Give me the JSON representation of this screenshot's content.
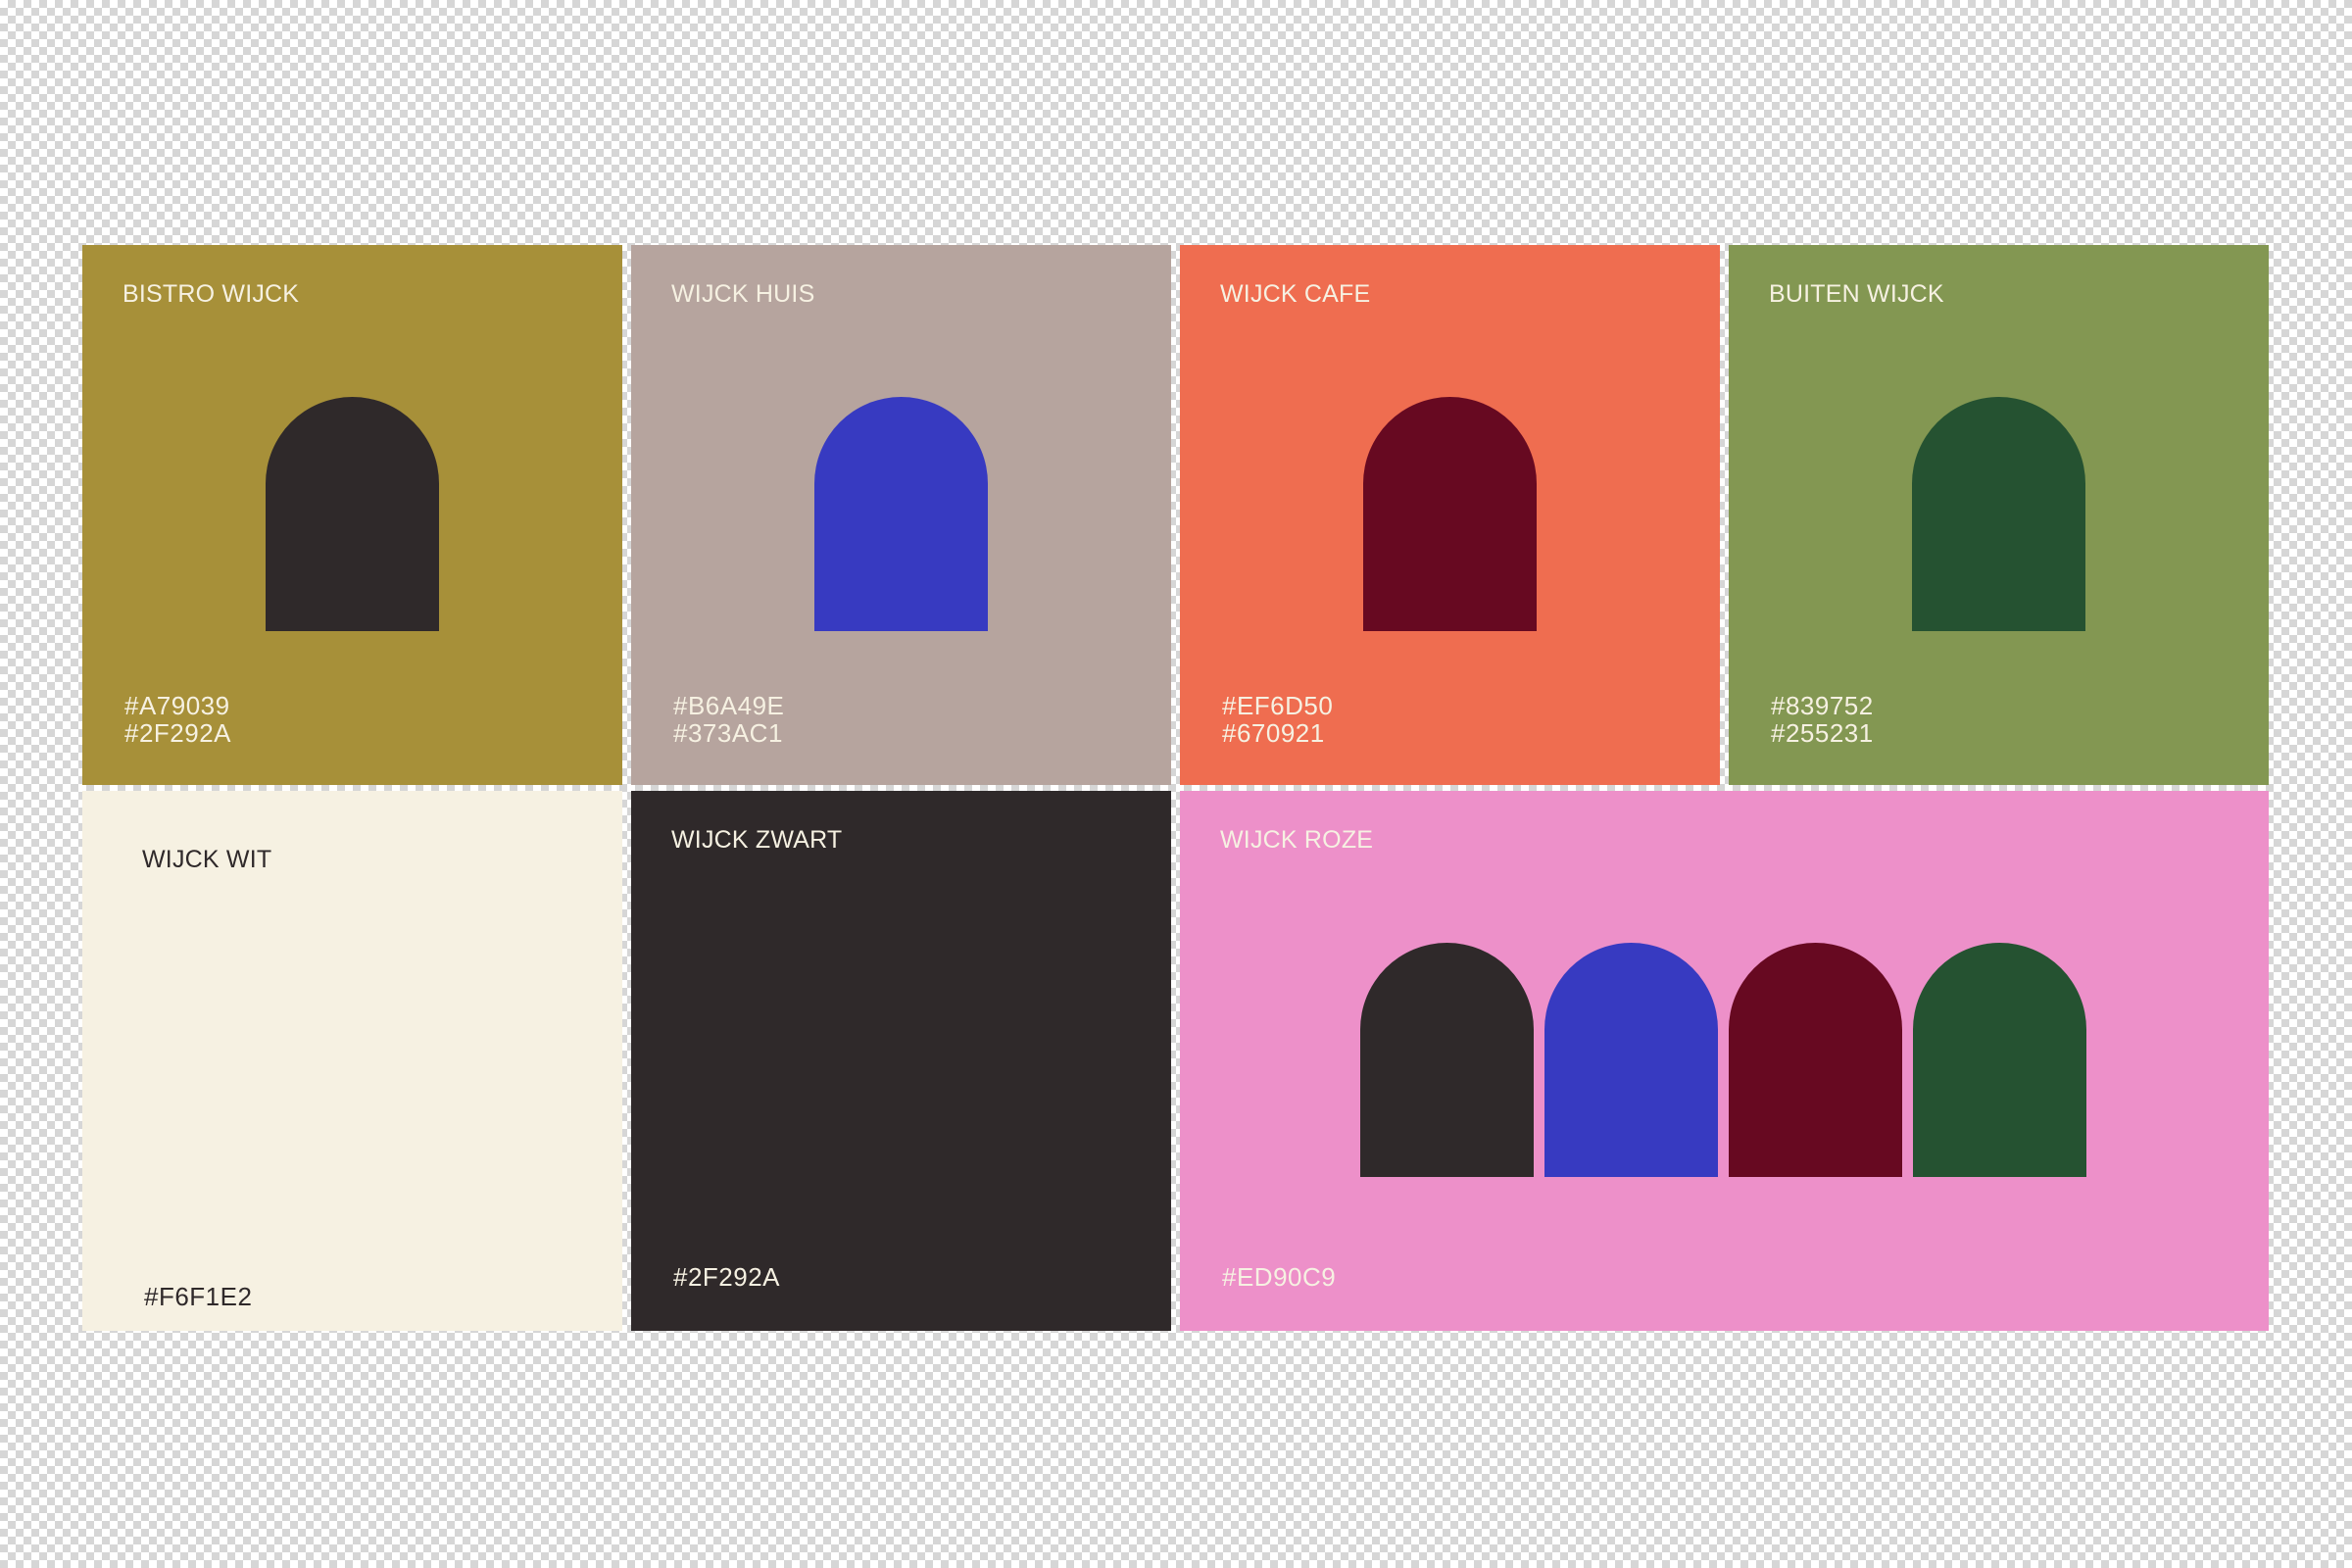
{
  "tiles": {
    "bistro": {
      "name": "BISTRO WIJCK",
      "codes": [
        "#A79039",
        "#2F292A"
      ],
      "bg": "#A79039",
      "arch": "#2F292A",
      "text": "#F6F1E2"
    },
    "huis": {
      "name": "WIJCK HUIS",
      "codes": [
        "#B6A49E",
        "#373AC1"
      ],
      "bg": "#B6A49E",
      "arch": "#373AC1",
      "text": "#F6F1E2"
    },
    "cafe": {
      "name": "WIJCK CAFE",
      "codes": [
        "#EF6D50",
        "#670921"
      ],
      "bg": "#EF6D50",
      "arch": "#670921",
      "text": "#F6F1E2"
    },
    "buiten": {
      "name": "BUITEN WIJCK",
      "codes": [
        "#839752",
        "#255231"
      ],
      "bg": "#839752",
      "arch": "#255231",
      "text": "#F6F1E2"
    },
    "wit": {
      "name": "WIJCK WIT",
      "code": "#F6F1E2",
      "bg": "#F6F1E2",
      "text": "#2F292A"
    },
    "zwart": {
      "name": "WIJCK ZWART",
      "code": "#2F292A",
      "bg": "#2F292A",
      "text": "#F6F1E2"
    },
    "roze": {
      "name": "WIJCK ROZE",
      "code": "#ED90C9",
      "bg": "#ED90C9",
      "text": "#F6F1E2",
      "arches": [
        "#2F292A",
        "#373AC1",
        "#670921",
        "#255231"
      ]
    }
  }
}
